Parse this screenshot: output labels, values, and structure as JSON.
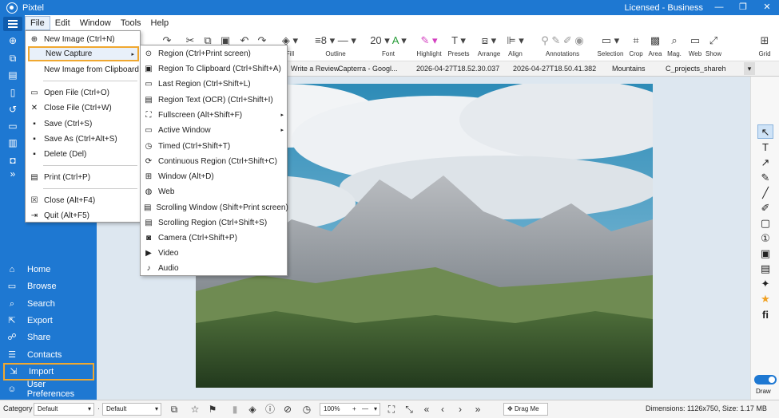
{
  "app": {
    "title": "Pixtel",
    "license": "Licensed - Business"
  },
  "window_controls": {
    "minimize": "—",
    "restore": "❐",
    "close": "✕"
  },
  "menubar": [
    "File",
    "Edit",
    "Window",
    "Tools",
    "Help"
  ],
  "toolbar": {
    "fill": "Fill",
    "outline": "Outline",
    "outline_width": "8",
    "font": "Font",
    "font_size": "20",
    "highlight": "Highlight",
    "presets": "Presets",
    "arrange": "Arrange",
    "align": "Align",
    "annotations": "Annotations",
    "selection": "Selection",
    "crop": "Crop",
    "area": "Area",
    "mag": "Mag.",
    "web": "Web",
    "show": "Show",
    "grid": "Grid"
  },
  "tabs": [
    "Write a Review",
    "Capterra - Googl...",
    "2026-04-27T18.52.30.037",
    "2026-04-27T18.50.41.382",
    "Mountains",
    "C_projects_sharehub..."
  ],
  "sidebar": {
    "items": [
      {
        "label": "Home",
        "icon": "home-icon",
        "glyph": "⌂"
      },
      {
        "label": "Browse",
        "icon": "browse-icon",
        "glyph": "▭"
      },
      {
        "label": "Search",
        "icon": "search-icon",
        "glyph": "⌕"
      },
      {
        "label": "Export",
        "icon": "export-icon",
        "glyph": "⇱"
      },
      {
        "label": "Share",
        "icon": "share-icon",
        "glyph": "☍"
      },
      {
        "label": "Contacts",
        "icon": "contacts-icon",
        "glyph": "☰"
      },
      {
        "label": "Import",
        "icon": "import-icon",
        "glyph": "⇲"
      },
      {
        "label": "User Preferences",
        "icon": "user-icon",
        "glyph": "☺"
      }
    ]
  },
  "file_menu": {
    "items": [
      {
        "label": "New Image (Ctrl+N)",
        "icon": "new-image-icon",
        "glyph": "⊕"
      },
      {
        "label": "New Capture",
        "icon": "capture-icon",
        "glyph": "",
        "submenu": true
      },
      {
        "label": "New Image from Clipboard",
        "icon": "clipboard-icon",
        "glyph": ""
      },
      {
        "label": "Open File (Ctrl+O)",
        "icon": "open-icon",
        "glyph": "▭"
      },
      {
        "label": "Close File (Ctrl+W)",
        "icon": "close-icon",
        "glyph": "✕"
      },
      {
        "label": "Save (Ctrl+S)",
        "icon": "save-icon",
        "glyph": "▪"
      },
      {
        "label": "Save As (Ctrl+Alt+S)",
        "icon": "save-as-icon",
        "glyph": "▪"
      },
      {
        "label": "Delete (Del)",
        "icon": "delete-icon",
        "glyph": "▪"
      },
      {
        "label": "Print (Ctrl+P)",
        "icon": "print-icon",
        "glyph": "▤"
      },
      {
        "label": "Close (Alt+F4)",
        "icon": "close-window-icon",
        "glyph": "☒"
      },
      {
        "label": "Quit (Alt+F5)",
        "icon": "quit-icon",
        "glyph": "⇥"
      }
    ]
  },
  "capture_submenu": {
    "items": [
      {
        "label": "Region (Ctrl+Print screen)",
        "icon": "region-icon",
        "glyph": "⊙"
      },
      {
        "label": "Region To Clipboard (Ctrl+Shift+A)",
        "icon": "region-clipboard-icon",
        "glyph": "▣"
      },
      {
        "label": "Last Region (Ctrl+Shift+L)",
        "icon": "last-region-icon",
        "glyph": "▭"
      },
      {
        "label": "Region Text (OCR) (Ctrl+Shift+I)",
        "icon": "ocr-icon",
        "glyph": "▤"
      },
      {
        "label": "Fullscreen (Alt+Shift+F)",
        "icon": "fullscreen-icon",
        "glyph": "⛶",
        "submenu": true
      },
      {
        "label": "Active Window",
        "icon": "active-window-icon",
        "glyph": "▭",
        "submenu": true
      },
      {
        "label": "Timed (Ctrl+Shift+T)",
        "icon": "timer-icon",
        "glyph": "◷"
      },
      {
        "label": "Continuous Region (Ctrl+Shift+C)",
        "icon": "continuous-icon",
        "glyph": "⟳"
      },
      {
        "label": "Window (Alt+D)",
        "icon": "window-icon",
        "glyph": "⊞"
      },
      {
        "label": "Web",
        "icon": "web-icon",
        "glyph": "◍"
      },
      {
        "label": "Scrolling Window (Shift+Print screen)",
        "icon": "scroll-window-icon",
        "glyph": "▤"
      },
      {
        "label": "Scrolling Region (Ctrl+Shift+S)",
        "icon": "scroll-region-icon",
        "glyph": "▤"
      },
      {
        "label": "Camera (Ctrl+Shift+P)",
        "icon": "camera-icon",
        "glyph": "◙"
      },
      {
        "label": "Video",
        "icon": "video-icon",
        "glyph": "▶"
      },
      {
        "label": "Audio",
        "icon": "audio-icon",
        "glyph": "♪"
      }
    ]
  },
  "right_palette": {
    "draw_label": "Draw"
  },
  "statusbar": {
    "category_label": "Category",
    "category_value": "Default",
    "second_value": "Default",
    "zoom": "100%",
    "drag_me": "Drag Me",
    "dimensions": "Dimensions: 1126x750, Size: 1.17 MB"
  },
  "colors": {
    "accent": "#1e78d2",
    "highlight_border": "#f0a830"
  }
}
